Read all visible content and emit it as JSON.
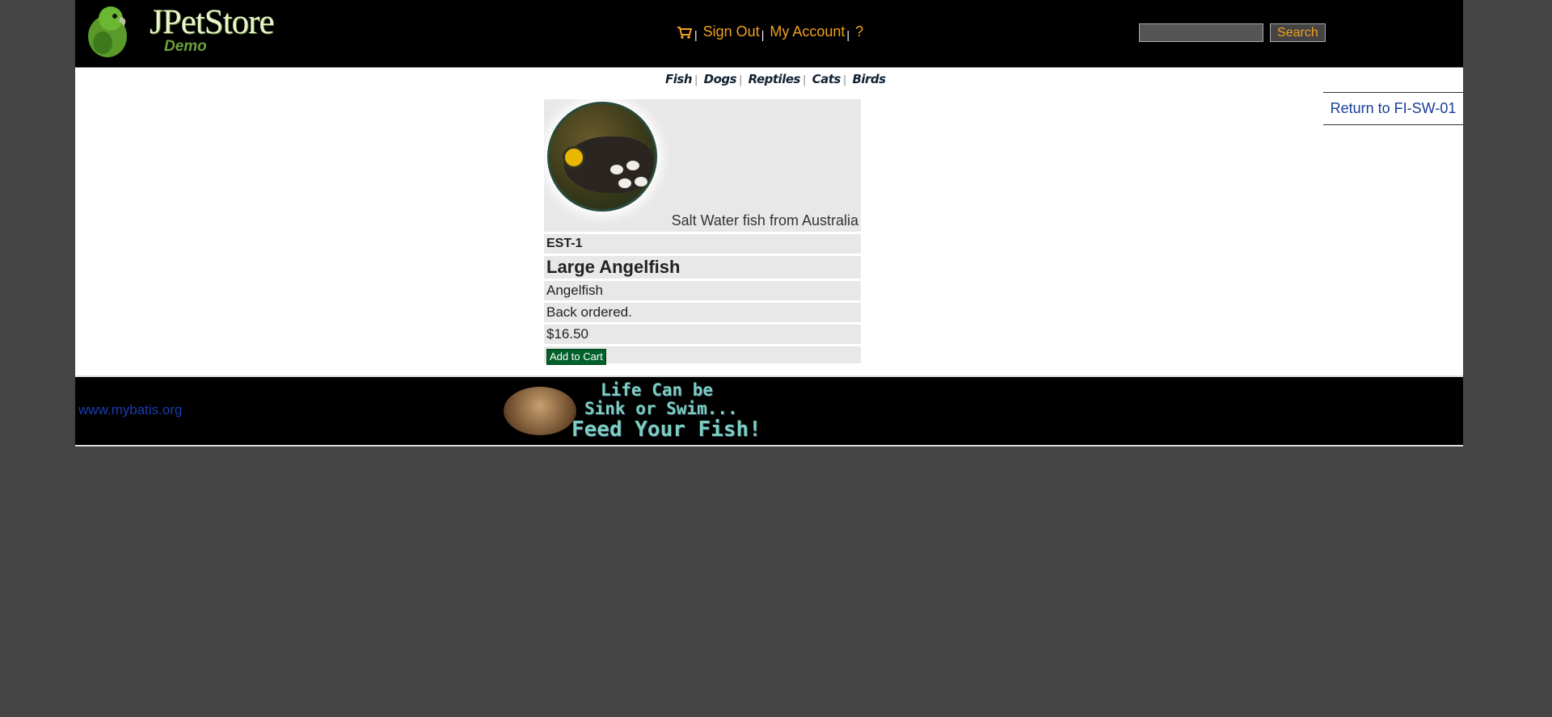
{
  "header": {
    "logo_title": "JPetStore",
    "logo_sub": "Demo",
    "menu": {
      "cart_icon": "cart-icon",
      "sign_out": "Sign Out",
      "my_account": "My Account",
      "help": "?",
      "separator": "|"
    },
    "search": {
      "value": "",
      "button_label": "Search"
    }
  },
  "quicklinks": [
    "Fish",
    "Dogs",
    "Reptiles",
    "Cats",
    "Birds"
  ],
  "back_link": "Return to FI-SW-01",
  "item": {
    "description": "Salt Water fish from Australia",
    "item_id": "EST-1",
    "name": "Large Angelfish",
    "product": "Angelfish",
    "stock": "Back ordered.",
    "price": "$16.50",
    "add_label": "Add to Cart"
  },
  "footer": {
    "link": "www.mybatis.org",
    "banner_lines": [
      "Life Can be",
      "Sink or Swim...",
      "Feed Your Fish!"
    ]
  },
  "colors": {
    "link_orange": "#f0a020",
    "link_blue": "#1a3c96",
    "button_green": "#00602a",
    "page_bg": "#444444"
  }
}
